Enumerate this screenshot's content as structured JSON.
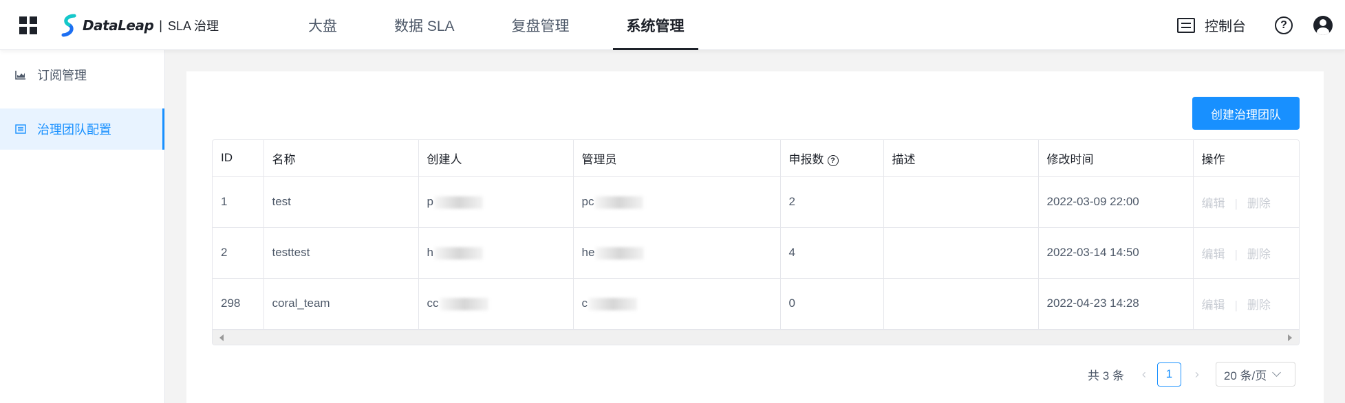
{
  "header": {
    "logo_text": "DataLeap",
    "logo_separator": "|",
    "logo_subtitle": "SLA 治理",
    "nav": [
      {
        "label": "大盘",
        "active": false
      },
      {
        "label": "数据 SLA",
        "active": false
      },
      {
        "label": "复盘管理",
        "active": false
      },
      {
        "label": "系统管理",
        "active": true
      }
    ],
    "console_label": "控制台",
    "help_glyph": "?"
  },
  "sidebar": {
    "items": [
      {
        "label": "订阅管理",
        "icon": "chart-icon",
        "active": false
      },
      {
        "label": "治理团队配置",
        "icon": "list-icon",
        "active": true
      }
    ]
  },
  "main": {
    "create_button": "创建治理团队",
    "table": {
      "columns": [
        "ID",
        "名称",
        "创建人",
        "管理员",
        "申报数",
        "描述",
        "修改时间",
        "操作"
      ],
      "help_glyph": "?",
      "rows": [
        {
          "id": "1",
          "name": "test",
          "creator": "p",
          "admin": "pc",
          "reports": "2",
          "desc": "",
          "modified": "2022-03-09 22:00"
        },
        {
          "id": "2",
          "name": "testtest",
          "creator": "h",
          "admin": "he",
          "reports": "4",
          "desc": "",
          "modified": "2022-03-14 14:50"
        },
        {
          "id": "298",
          "name": "coral_team",
          "creator": "cc",
          "admin": "c",
          "reports": "0",
          "desc": "",
          "modified": "2022-04-23 14:28"
        }
      ],
      "actions": {
        "edit": "编辑",
        "separator": "|",
        "delete": "删除"
      }
    },
    "pagination": {
      "total": "共 3 条",
      "current_page": "1",
      "page_size": "20 条/页"
    }
  },
  "colors": {
    "primary": "#1890ff",
    "active_bg": "#e8f3ff",
    "text": "#1d2129",
    "muted": "#c9cdd4"
  }
}
